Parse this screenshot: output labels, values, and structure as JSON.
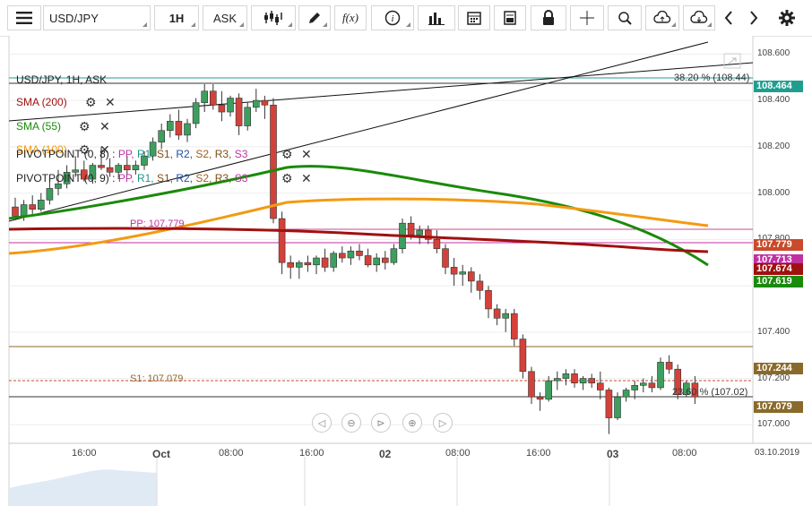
{
  "toolbar": {
    "symbol": "USD/JPY",
    "timeframe": "1H",
    "price_type": "ASK",
    "fx_label": "f(x)"
  },
  "chart_info": "USD/JPY, 1H, ASK",
  "legend": [
    {
      "label": "SMA (200)",
      "color": "#a01010"
    },
    {
      "label": "SMA (55)",
      "color": "#1a8a0a"
    },
    {
      "label": "SMA (100)",
      "color": "#f39a12"
    }
  ],
  "pivot_legends": [
    {
      "label": "PIVOTPOINT (0, 8)",
      "items": [
        "PP",
        "R1",
        "S1",
        "R2",
        "S2",
        "R3",
        "S3"
      ]
    },
    {
      "label": "PIVOTPOINT (0, 9)",
      "items": [
        "PP",
        "R1",
        "S1",
        "R2",
        "S2",
        "R3",
        "S3"
      ]
    }
  ],
  "pivot_colors": [
    "#c030a0",
    "#1a9a8a",
    "#805010",
    "#2050a0",
    "#a06010",
    "#805010",
    "#c030a0"
  ],
  "annotations": {
    "fib_top": "38.20 % (108.44)",
    "fib_bottom": "23.60 % (107.02)",
    "pp_label": "PP: 107.779",
    "s1_label": "S1: 107.079"
  },
  "price_axis": [
    "108.600",
    "108.400",
    "108.200",
    "108.000",
    "107.800",
    "107.600",
    "107.400",
    "107.200",
    "107.000"
  ],
  "price_tags": [
    {
      "value": "108.464",
      "color": "#1f9e8e"
    },
    {
      "value": "107.779",
      "color": "#c94a2c"
    },
    {
      "value": "107.713",
      "color": "#c030a0"
    },
    {
      "value": "107.674",
      "color": "#a01010"
    },
    {
      "value": "107.619",
      "color": "#1a8a0a"
    },
    {
      "value": "107.244",
      "color": "#8a6a2a"
    },
    {
      "value": "107.079",
      "color": "#8a6a2a"
    }
  ],
  "time_axis": [
    "16:00",
    "Oct",
    "08:00",
    "16:00",
    "02",
    "08:00",
    "16:00",
    "03",
    "08:00"
  ],
  "date_end": "03.10.2019",
  "chart_data": {
    "type": "candlestick",
    "ylim": [
      106.92,
      108.64
    ],
    "candles": [
      [
        107.94,
        107.98,
        107.89,
        107.9
      ],
      [
        107.9,
        107.97,
        107.88,
        107.95
      ],
      [
        107.95,
        107.99,
        107.91,
        107.93
      ],
      [
        107.93,
        108.0,
        107.92,
        107.97
      ],
      [
        107.97,
        108.05,
        107.95,
        108.02
      ],
      [
        108.02,
        108.1,
        107.99,
        108.04
      ],
      [
        108.04,
        108.12,
        108.02,
        108.09
      ],
      [
        108.09,
        108.16,
        108.07,
        108.1
      ],
      [
        108.1,
        108.14,
        108.05,
        108.06
      ],
      [
        108.06,
        108.13,
        108.04,
        108.12
      ],
      [
        108.12,
        108.2,
        108.1,
        108.11
      ],
      [
        108.11,
        108.15,
        108.07,
        108.09
      ],
      [
        108.09,
        108.13,
        108.06,
        108.12
      ],
      [
        108.12,
        108.16,
        108.08,
        108.1
      ],
      [
        108.1,
        108.14,
        108.08,
        108.12
      ],
      [
        108.12,
        108.18,
        108.1,
        108.16
      ],
      [
        108.16,
        108.24,
        108.14,
        108.22
      ],
      [
        108.22,
        108.3,
        108.19,
        108.27
      ],
      [
        108.27,
        108.34,
        108.24,
        108.31
      ],
      [
        108.31,
        108.36,
        108.23,
        108.25
      ],
      [
        108.25,
        108.32,
        108.22,
        108.3
      ],
      [
        108.3,
        108.41,
        108.28,
        108.39
      ],
      [
        108.39,
        108.47,
        108.35,
        108.44
      ],
      [
        108.44,
        108.47,
        108.36,
        108.38
      ],
      [
        108.38,
        108.44,
        108.31,
        108.35
      ],
      [
        108.35,
        108.42,
        108.33,
        108.41
      ],
      [
        108.41,
        108.43,
        108.25,
        108.29
      ],
      [
        108.29,
        108.39,
        108.27,
        108.37
      ],
      [
        108.37,
        108.45,
        108.35,
        108.4
      ],
      [
        108.4,
        108.42,
        108.32,
        108.38
      ],
      [
        108.38,
        108.41,
        107.87,
        107.89
      ],
      [
        107.89,
        107.92,
        107.65,
        107.7
      ],
      [
        107.7,
        107.73,
        107.63,
        107.68
      ],
      [
        107.68,
        107.71,
        107.63,
        107.7
      ],
      [
        107.7,
        107.73,
        107.66,
        107.69
      ],
      [
        107.69,
        107.73,
        107.65,
        107.72
      ],
      [
        107.72,
        107.76,
        107.66,
        107.68
      ],
      [
        107.68,
        107.75,
        107.66,
        107.74
      ],
      [
        107.74,
        107.77,
        107.7,
        107.72
      ],
      [
        107.72,
        107.77,
        107.69,
        107.75
      ],
      [
        107.75,
        107.78,
        107.71,
        107.73
      ],
      [
        107.73,
        107.76,
        107.68,
        107.69
      ],
      [
        107.69,
        107.74,
        107.66,
        107.72
      ],
      [
        107.72,
        107.75,
        107.67,
        107.7
      ],
      [
        107.7,
        107.78,
        107.69,
        107.76
      ],
      [
        107.76,
        107.89,
        107.74,
        107.87
      ],
      [
        107.87,
        107.9,
        107.8,
        107.82
      ],
      [
        107.82,
        107.86,
        107.78,
        107.84
      ],
      [
        107.84,
        107.86,
        107.78,
        107.8
      ],
      [
        107.8,
        107.84,
        107.74,
        107.76
      ],
      [
        107.76,
        107.78,
        107.65,
        107.68
      ],
      [
        107.68,
        107.72,
        107.6,
        107.65
      ],
      [
        107.65,
        107.69,
        107.6,
        107.66
      ],
      [
        107.66,
        107.68,
        107.57,
        107.62
      ],
      [
        107.62,
        107.65,
        107.54,
        107.58
      ],
      [
        107.58,
        107.6,
        107.46,
        107.5
      ],
      [
        107.5,
        107.52,
        107.43,
        107.46
      ],
      [
        107.46,
        107.5,
        107.4,
        107.48
      ],
      [
        107.48,
        107.5,
        107.34,
        107.37
      ],
      [
        107.37,
        107.39,
        107.2,
        107.23
      ],
      [
        107.23,
        107.25,
        107.09,
        107.12
      ],
      [
        107.12,
        107.14,
        107.06,
        107.11
      ],
      [
        107.11,
        107.21,
        107.1,
        107.19
      ],
      [
        107.19,
        107.23,
        107.15,
        107.2
      ],
      [
        107.2,
        107.24,
        107.17,
        107.22
      ],
      [
        107.22,
        107.24,
        107.16,
        107.18
      ],
      [
        107.18,
        107.21,
        107.15,
        107.2
      ],
      [
        107.2,
        107.22,
        107.16,
        107.18
      ],
      [
        107.18,
        107.23,
        107.11,
        107.15
      ],
      [
        107.15,
        107.16,
        106.96,
        107.03
      ],
      [
        107.03,
        107.14,
        107.02,
        107.12
      ],
      [
        107.12,
        107.16,
        107.1,
        107.15
      ],
      [
        107.15,
        107.19,
        107.11,
        107.17
      ],
      [
        107.17,
        107.2,
        107.14,
        107.18
      ],
      [
        107.18,
        107.21,
        107.14,
        107.16
      ],
      [
        107.16,
        107.29,
        107.15,
        107.27
      ],
      [
        107.27,
        107.3,
        107.22,
        107.24
      ],
      [
        107.24,
        107.26,
        107.11,
        107.13
      ],
      [
        107.13,
        107.19,
        107.12,
        107.18
      ],
      [
        107.18,
        107.21,
        107.09,
        107.12
      ]
    ]
  }
}
